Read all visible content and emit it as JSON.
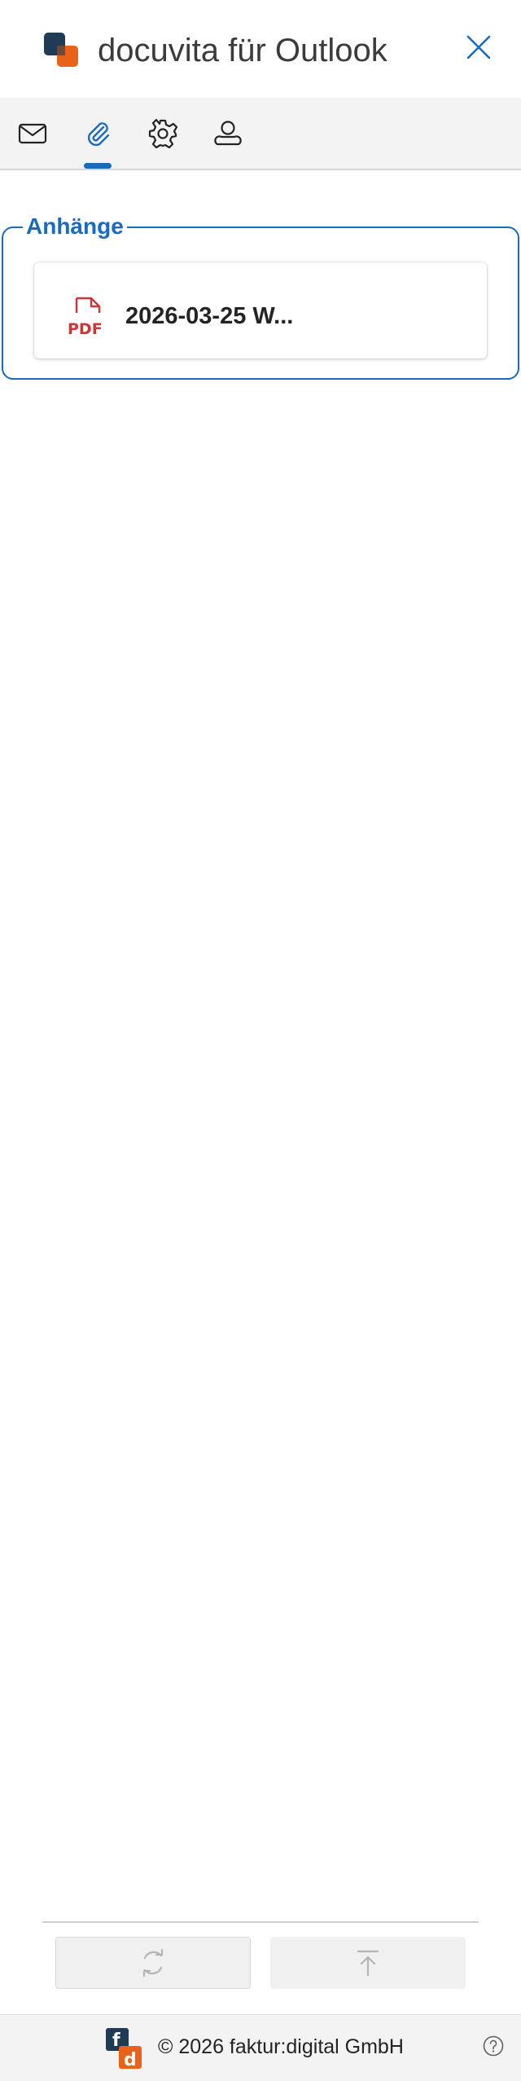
{
  "header": {
    "title": "docuvita für Outlook",
    "logo_icon": "docuvita-logo",
    "close_icon": "close-icon"
  },
  "tabs": [
    {
      "name": "mail",
      "icon": "mail-icon",
      "active": false
    },
    {
      "name": "attachments",
      "icon": "paperclip-icon",
      "active": true
    },
    {
      "name": "settings",
      "icon": "gear-icon",
      "active": false
    },
    {
      "name": "user",
      "icon": "user-icon",
      "active": false
    }
  ],
  "attachments": {
    "legend": "Anhänge",
    "items": [
      {
        "name": "2026-03-25 W...",
        "icon": "pdf-icon",
        "icon_label": "PDF"
      }
    ]
  },
  "actions": {
    "refresh_icon": "refresh-icon",
    "upload_icon": "upload-icon"
  },
  "footer": {
    "logo_letters": [
      "f",
      "d"
    ],
    "copyright": "© 2026 faktur:digital GmbH",
    "help_icon": "help-icon"
  },
  "colors": {
    "accent": "#1a6bc0",
    "brand_orange": "#e8621a",
    "brand_navy": "#1f3b55",
    "pdf_red": "#d13438"
  }
}
